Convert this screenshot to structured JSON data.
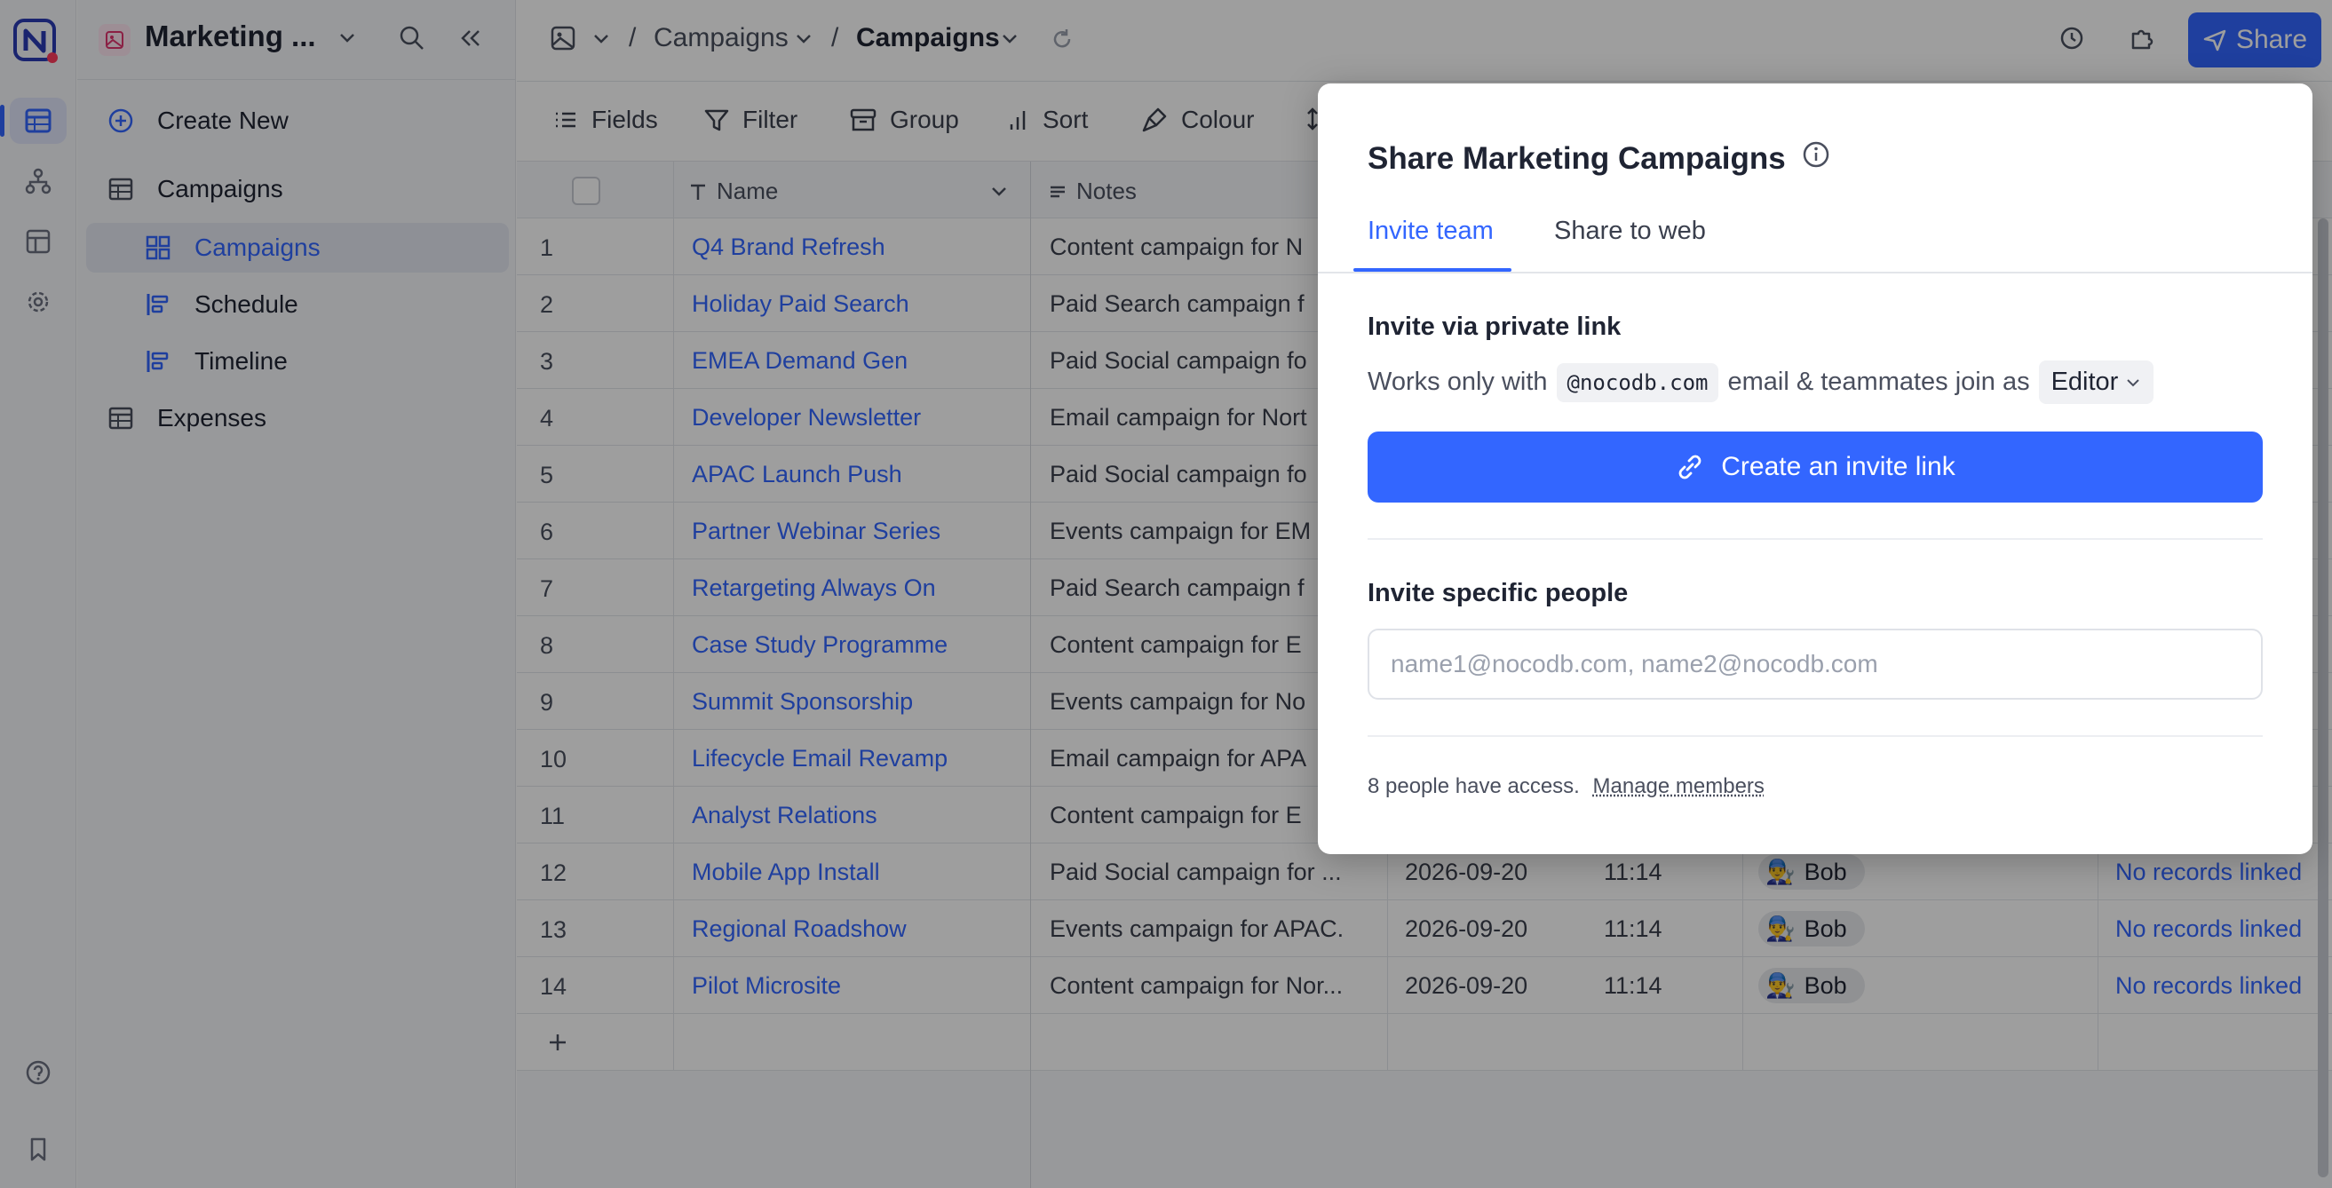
{
  "workspace": {
    "title": "Marketing ..."
  },
  "sidebar": {
    "create_new": "Create New",
    "tables": [
      {
        "label": "Campaigns",
        "views": [
          "Campaigns",
          "Schedule",
          "Timeline"
        ]
      },
      {
        "label": "Expenses"
      }
    ]
  },
  "breadcrumb": {
    "table": "Campaigns",
    "view": "Campaigns"
  },
  "topbar": {
    "share_label": "Share"
  },
  "toolbar": {
    "fields": "Fields",
    "filter": "Filter",
    "group": "Group",
    "sort": "Sort",
    "colour": "Colour"
  },
  "grid": {
    "columns": {
      "name": "Name",
      "notes": "Notes"
    },
    "rows": [
      {
        "n": "1",
        "name": "Q4 Brand Refresh",
        "notes": "Content campaign for N"
      },
      {
        "n": "2",
        "name": "Holiday Paid Search",
        "notes": "Paid Search campaign f"
      },
      {
        "n": "3",
        "name": "EMEA Demand Gen",
        "notes": "Paid Social campaign fo"
      },
      {
        "n": "4",
        "name": "Developer Newsletter",
        "notes": "Email campaign for Nort"
      },
      {
        "n": "5",
        "name": "APAC Launch Push",
        "notes": "Paid Social campaign fo"
      },
      {
        "n": "6",
        "name": "Partner Webinar Series",
        "notes": "Events campaign for EM"
      },
      {
        "n": "7",
        "name": "Retargeting Always On",
        "notes": "Paid Search campaign f"
      },
      {
        "n": "8",
        "name": "Case Study Programme",
        "notes": "Content campaign for E"
      },
      {
        "n": "9",
        "name": "Summit Sponsorship",
        "notes": "Events campaign for No"
      },
      {
        "n": "10",
        "name": "Lifecycle Email Revamp",
        "notes": "Email campaign for APA"
      },
      {
        "n": "11",
        "name": "Analyst Relations",
        "notes": "Content campaign for E"
      },
      {
        "n": "12",
        "name": "Mobile App Install",
        "notes": "Paid Social campaign for ...",
        "date": "2026-09-20",
        "time": "11:14",
        "user": "Bob",
        "link": "No records linked"
      },
      {
        "n": "13",
        "name": "Regional Roadshow",
        "notes": "Events campaign for APAC.",
        "date": "2026-09-20",
        "time": "11:14",
        "user": "Bob",
        "link": "No records linked"
      },
      {
        "n": "14",
        "name": "Pilot Microsite",
        "notes": "Content campaign for Nor...",
        "date": "2026-09-20",
        "time": "11:14",
        "user": "Bob",
        "link": "No records linked"
      }
    ]
  },
  "modal": {
    "title": "Share Marketing Campaigns",
    "tabs": [
      "Invite team",
      "Share to web"
    ],
    "private_link": {
      "heading": "Invite via private link",
      "works_only_with": "Works only with",
      "domain": "@nocodb.com",
      "join_text": "email & teammates join as",
      "role": "Editor",
      "button": "Create an invite link"
    },
    "specific": {
      "heading": "Invite specific people",
      "placeholder": "name1@nocodb.com, name2@nocodb.com"
    },
    "access": {
      "text": "8 people have access.",
      "manage": "Manage members"
    }
  },
  "colors": {
    "accent": "#3366ff",
    "overlay": "rgba(0,0,0,0.38)"
  }
}
